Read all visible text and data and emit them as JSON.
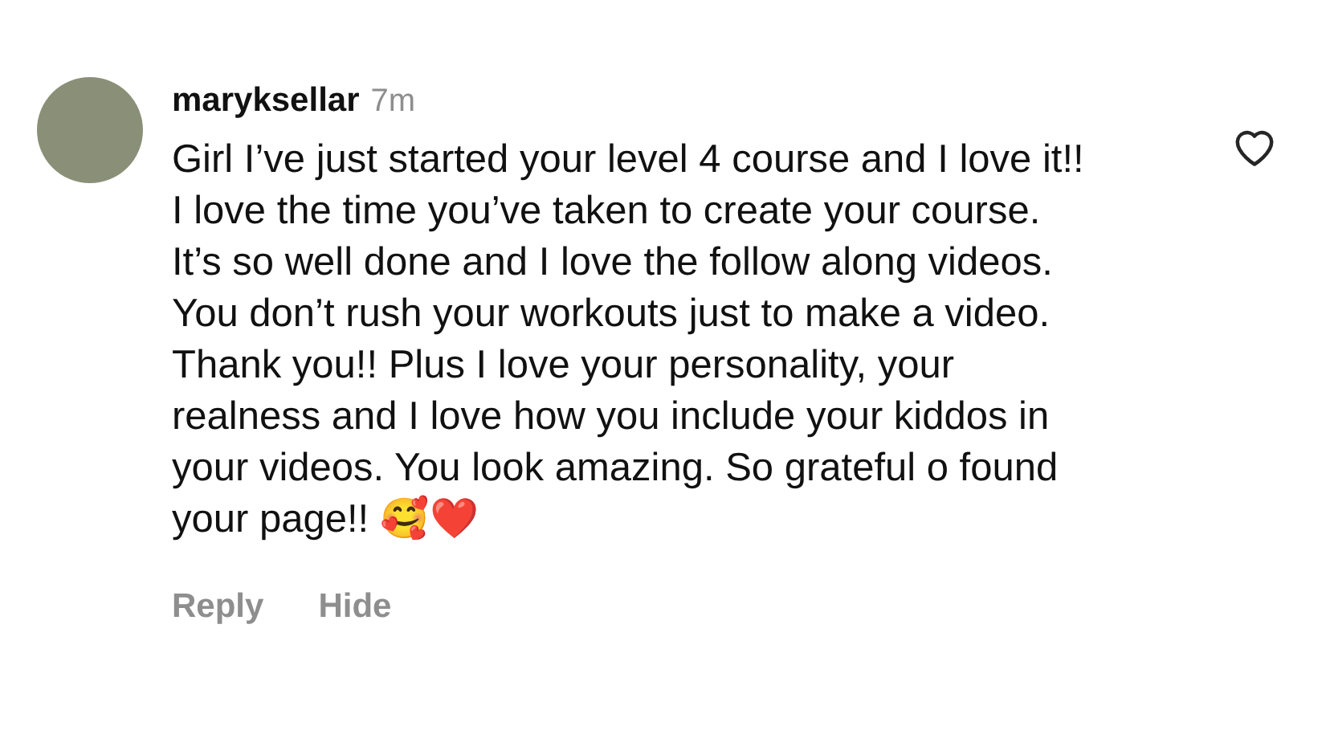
{
  "comment": {
    "username": "maryksellar",
    "time": "7m",
    "text": "Girl I’ve just started your level 4 course and I love it!! I love the time you’ve taken to create your course. It’s so well done and I love the follow along videos. You don’t rush your workouts just to make a video. Thank you!! Plus I love your personality, your realness and I love how you include your kiddos in your videos. You look amazing. So grateful o found your page!! 🥰❤️",
    "liked": false,
    "actions": [
      "Reply",
      "Hide"
    ]
  }
}
